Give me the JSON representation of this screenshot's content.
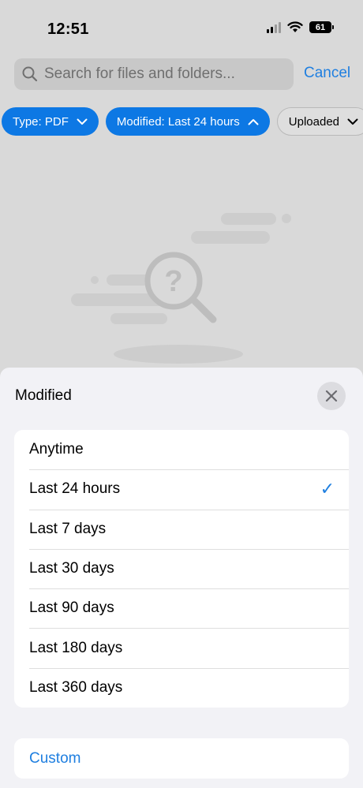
{
  "status_bar": {
    "time": "12:51",
    "battery": "61"
  },
  "search": {
    "placeholder": "Search for files and folders...",
    "cancel_label": "Cancel"
  },
  "filters": [
    {
      "label": "Type: PDF",
      "active": true
    },
    {
      "label": "Modified: Last 24 hours",
      "active": true
    },
    {
      "label": "Uploaded",
      "active": false
    }
  ],
  "sheet": {
    "title": "Modified",
    "options": [
      {
        "label": "Anytime",
        "selected": false
      },
      {
        "label": "Last 24 hours",
        "selected": true
      },
      {
        "label": "Last 7 days",
        "selected": false
      },
      {
        "label": "Last 30 days",
        "selected": false
      },
      {
        "label": "Last 90 days",
        "selected": false
      },
      {
        "label": "Last 180 days",
        "selected": false
      },
      {
        "label": "Last 360 days",
        "selected": false
      }
    ],
    "custom_label": "Custom",
    "check_glyph": "✓"
  },
  "colors": {
    "accent": "#1f7fe0",
    "chip_active": "#0d78e4"
  }
}
